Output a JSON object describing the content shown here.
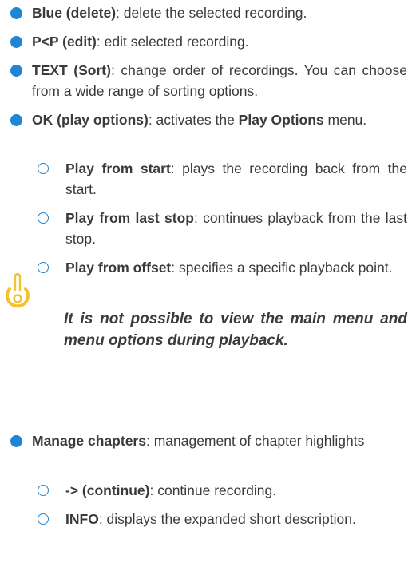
{
  "bullets": [
    {
      "term": "Blue (delete)",
      "desc": ": delete the selected recording."
    },
    {
      "term": "P<P (edit)",
      "desc": ": edit selected recording."
    },
    {
      "term": "TEXT (Sort)",
      "desc": ": change order of recordings. You can choose from a wide range of sorting options."
    },
    {
      "term": "OK (play options)",
      "desc_pre": ": activates the ",
      "desc_term": "Play Options",
      "desc_post": " menu."
    }
  ],
  "play_options": [
    {
      "term": "Play from start",
      "desc": ": plays the recording back from the start."
    },
    {
      "term": "Play from last stop",
      "desc": ": continues playback from the last stop."
    },
    {
      "term": "Play from offset",
      "desc": ": specifies a specific playback point."
    }
  ],
  "note": {
    "icon": "hint-icon",
    "text": "It is not possible to view the main menu and menu options during playback."
  },
  "chapters": {
    "term": "Manage chapters",
    "desc": ": management of chapter highlights"
  },
  "chapter_options": [
    {
      "term": "-> (continue)",
      "desc": ": continue recording."
    },
    {
      "term": "INFO",
      "desc": ": displays the expanded short description."
    }
  ],
  "colors": {
    "accent": "#1f86d6",
    "note_icon": "#f2c230",
    "text": "#3a3a3a"
  }
}
